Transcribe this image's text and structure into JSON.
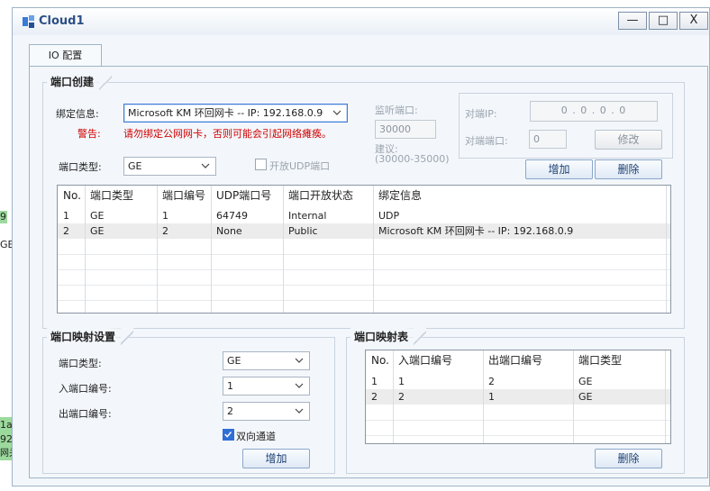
{
  "background": {
    "frag1": "9",
    "frag2": "GE",
    "frag3": "1a",
    "frag4": "92",
    "frag5": "网关"
  },
  "window": {
    "title": "Cloud1",
    "minimize": "—",
    "maximize": "□",
    "close": "X"
  },
  "tab": {
    "label": "IO 配置"
  },
  "port_create": {
    "title": "端口创建",
    "binding_label": "绑定信息:",
    "binding_value": "Microsoft KM 环回网卡 -- IP: 192.168.0.9",
    "warning_label": "警告:",
    "warning_text": "请勿绑定公网网卡，否则可能会引起网络瘫痪。",
    "listen_label": "监听端口:",
    "listen_value": "30000",
    "suggest_label": "建议:",
    "suggest_range": "(30000-35000)",
    "peer_ip_label": "对端IP:",
    "peer_ip_value": "0 . 0 . 0 . 0",
    "peer_port_label": "对端端口:",
    "peer_port_value": "0",
    "modify_button": "修改",
    "port_type_label": "端口类型:",
    "port_type_value": "GE",
    "udp_open_label": "开放UDP端口",
    "add_button": "增加",
    "delete_button": "删除",
    "table": {
      "headers": [
        "No.",
        "端口类型",
        "端口编号",
        "UDP端口号",
        "端口开放状态",
        "绑定信息"
      ],
      "rows": [
        [
          "1",
          "GE",
          "1",
          "64749",
          "Internal",
          "UDP"
        ],
        [
          "2",
          "GE",
          "2",
          "None",
          "Public",
          "Microsoft KM 环回网卡 -- IP: 192.168.0.9"
        ]
      ]
    }
  },
  "mapping_settings": {
    "title": "端口映射设置",
    "port_type_label": "端口类型:",
    "port_type_value": "GE",
    "in_port_label": "入端口编号:",
    "in_port_value": "1",
    "out_port_label": "出端口编号:",
    "out_port_value": "2",
    "bidirectional_label": "双向通道",
    "bidirectional_checked": true,
    "add_button": "增加"
  },
  "mapping_table": {
    "title": "端口映射表",
    "headers": [
      "No.",
      "入端口编号",
      "出端口编号",
      "端口类型"
    ],
    "rows": [
      [
        "1",
        "1",
        "2",
        "GE"
      ],
      [
        "2",
        "2",
        "1",
        "GE"
      ]
    ],
    "delete_button": "删除"
  },
  "colors": {
    "accent": "#2f6fd6",
    "warning": "#d00000",
    "title_text": "#2d4f86"
  }
}
